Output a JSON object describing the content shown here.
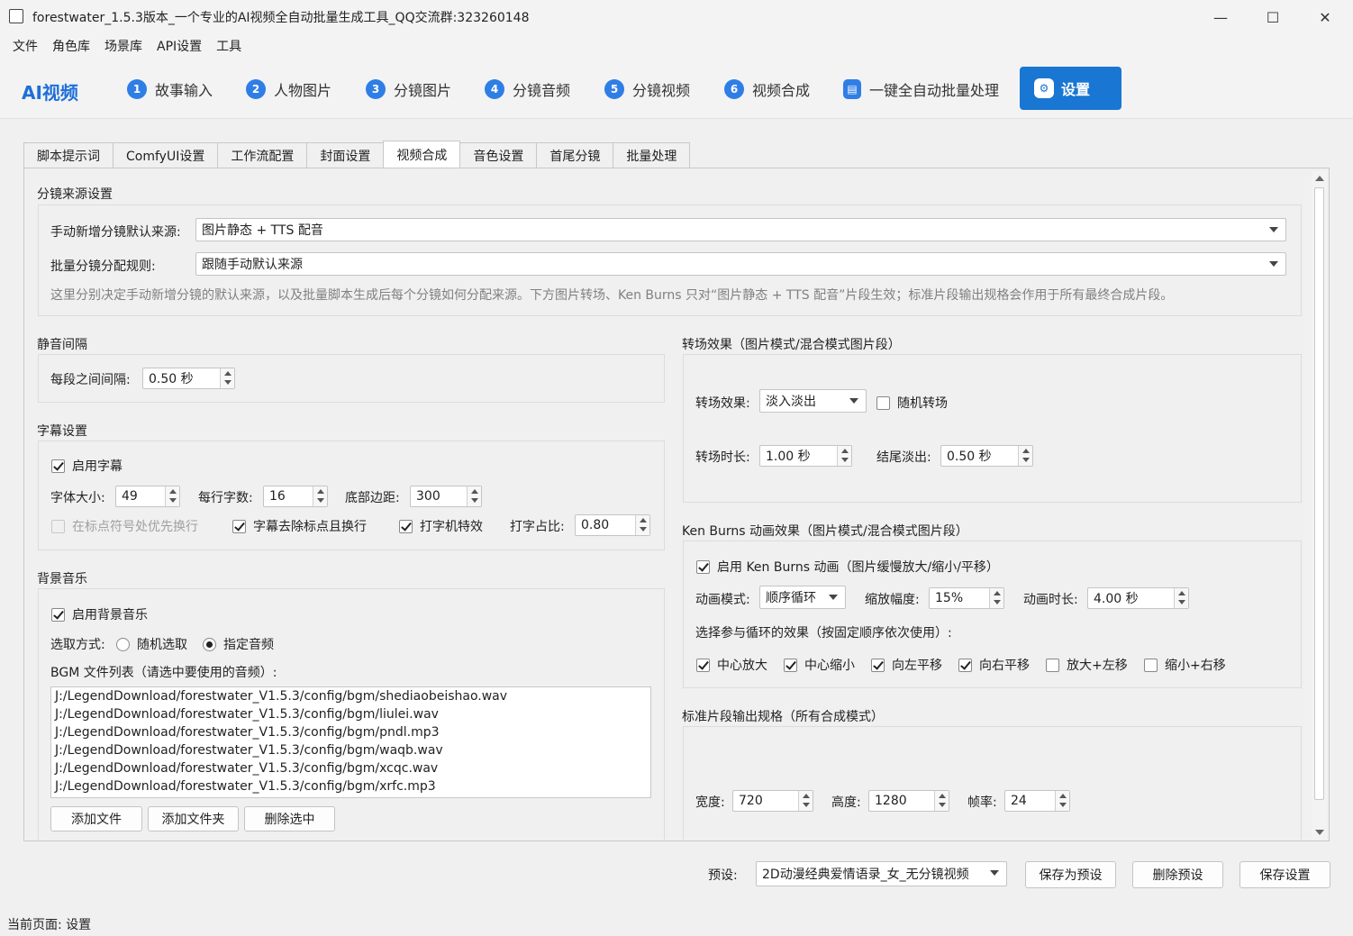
{
  "window": {
    "title": "forestwater_1.5.3版本_一个专业的AI视频全自动批量生成工具_QQ交流群:323260148",
    "minimize": "—",
    "maximize": "☐",
    "close": "✕"
  },
  "menu": [
    "文件",
    "角色库",
    "场景库",
    "API设置",
    "工具"
  ],
  "nav": {
    "brand": "AI视频",
    "steps": [
      {
        "num": "1",
        "label": "故事输入"
      },
      {
        "num": "2",
        "label": "人物图片"
      },
      {
        "num": "3",
        "label": "分镜图片"
      },
      {
        "num": "4",
        "label": "分镜音频"
      },
      {
        "num": "5",
        "label": "分镜视频"
      },
      {
        "num": "6",
        "label": "视频合成"
      },
      {
        "num": "▤",
        "label": "一键全自动批量处理"
      }
    ],
    "settings": {
      "icon": "⚙",
      "label": "设置"
    }
  },
  "tabs": [
    "脚本提示词",
    "ComfyUI设置",
    "工作流配置",
    "封面设置",
    "视频合成",
    "音色设置",
    "首尾分镜",
    "批量处理"
  ],
  "source": {
    "title": "分镜来源设置",
    "manual_label": "手动新增分镜默认来源:",
    "manual_value": "图片静态 + TTS 配音",
    "batch_label": "批量分镜分配规则:",
    "batch_value": "跟随手动默认来源",
    "hint": "这里分别决定手动新增分镜的默认来源，以及批量脚本生成后每个分镜如何分配来源。下方图片转场、Ken Burns 只对“图片静态 + TTS 配音”片段生效；标准片段输出规格会作用于所有最终合成片段。"
  },
  "silence": {
    "title": "静音间隔",
    "label": "每段之间间隔:",
    "value": "0.50 秒"
  },
  "subtitle": {
    "title": "字幕设置",
    "enable": "启用字幕",
    "font_label": "字体大小:",
    "font_value": "49",
    "chars_label": "每行字数:",
    "chars_value": "16",
    "margin_label": "底部边距:",
    "margin_value": "300",
    "punct_break": "在标点符号处优先换行",
    "remove_punct": "字幕去除标点且换行",
    "typewriter": "打字机特效",
    "type_ratio_label": "打字占比:",
    "type_ratio_value": "0.80"
  },
  "bgm": {
    "title": "背景音乐",
    "enable": "启用背景音乐",
    "mode_label": "选取方式:",
    "random": "随机选取",
    "specified": "指定音频",
    "list_label": "BGM 文件列表（请选中要使用的音频）:",
    "files": [
      "J:/LegendDownload/forestwater_V1.5.3/config/bgm/shediaobeishao.wav",
      "J:/LegendDownload/forestwater_V1.5.3/config/bgm/liulei.wav",
      "J:/LegendDownload/forestwater_V1.5.3/config/bgm/pndl.mp3",
      "J:/LegendDownload/forestwater_V1.5.3/config/bgm/waqb.wav",
      "J:/LegendDownload/forestwater_V1.5.3/config/bgm/xcqc.wav",
      "J:/LegendDownload/forestwater_V1.5.3/config/bgm/xrfc.mp3"
    ],
    "add_file": "添加文件",
    "add_folder": "添加文件夹",
    "delete_selected": "删除选中"
  },
  "transition": {
    "title": "转场效果（图片模式/混合模式图片段）",
    "effect_label": "转场效果:",
    "effect_value": "淡入淡出",
    "random": "随机转场",
    "duration_label": "转场时长:",
    "duration_value": "1.00 秒",
    "fadeout_label": "结尾淡出:",
    "fadeout_value": "0.50 秒"
  },
  "kenburns": {
    "title": "Ken Burns 动画效果（图片模式/混合模式图片段）",
    "enable": "启用 Ken Burns 动画（图片缓慢放大/缩小/平移）",
    "mode_label": "动画模式:",
    "mode_value": "顺序循环",
    "zoom_label": "缩放幅度:",
    "zoom_value": "15%",
    "duration_label": "动画时长:",
    "duration_value": "4.00 秒",
    "cycle_label": "选择参与循环的效果（按固定顺序依次使用）:",
    "effects": [
      {
        "label": "中心放大",
        "checked": true
      },
      {
        "label": "中心缩小",
        "checked": true
      },
      {
        "label": "向左平移",
        "checked": true
      },
      {
        "label": "向右平移",
        "checked": true
      },
      {
        "label": "放大+左移",
        "checked": false
      },
      {
        "label": "缩小+右移",
        "checked": false
      }
    ]
  },
  "output": {
    "title": "标准片段输出规格（所有合成模式）",
    "width_label": "宽度:",
    "width_value": "720",
    "height_label": "高度:",
    "height_value": "1280",
    "fps_label": "帧率:",
    "fps_value": "24"
  },
  "footer": {
    "preset_label": "预设:",
    "preset_value": "2D动漫经典爱情语录_女_无分镜视频",
    "save_preset": "保存为预设",
    "delete_preset": "删除预设",
    "save_settings": "保存设置"
  },
  "status": "当前页面: 设置"
}
